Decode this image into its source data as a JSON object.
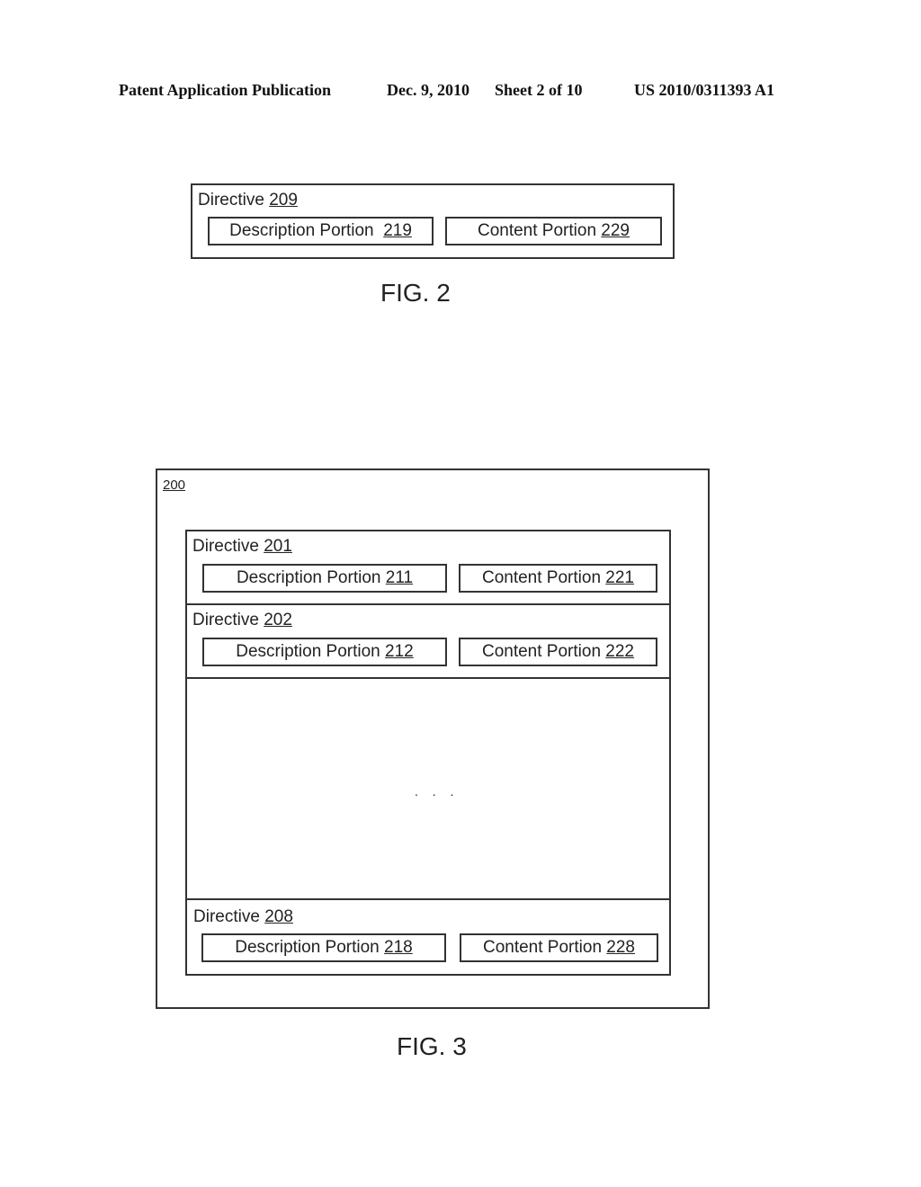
{
  "header": {
    "publication": "Patent Application Publication",
    "date": "Dec. 9, 2010",
    "sheet": "Sheet 2 of 10",
    "number": "US 2010/0311393 A1"
  },
  "fig2": {
    "caption": "FIG. 2",
    "directive": {
      "label": "Directive",
      "ref": "209"
    },
    "description": {
      "label": "Description Portion",
      "ref": "219"
    },
    "content": {
      "label": "Content Portion",
      "ref": "229"
    }
  },
  "fig3": {
    "caption": "FIG. 3",
    "container_ref": "200",
    "ellipsis": ". . .",
    "directives": [
      {
        "label": "Directive",
        "ref": "201",
        "description": {
          "label": "Description Portion",
          "ref": "211"
        },
        "content": {
          "label": "Content Portion",
          "ref": "221"
        }
      },
      {
        "label": "Directive",
        "ref": "202",
        "description": {
          "label": "Description Portion",
          "ref": "212"
        },
        "content": {
          "label": "Content Portion",
          "ref": "222"
        }
      },
      {
        "label": "Directive",
        "ref": "208",
        "description": {
          "label": "Description Portion",
          "ref": "218"
        },
        "content": {
          "label": "Content Portion",
          "ref": "228"
        }
      }
    ]
  }
}
